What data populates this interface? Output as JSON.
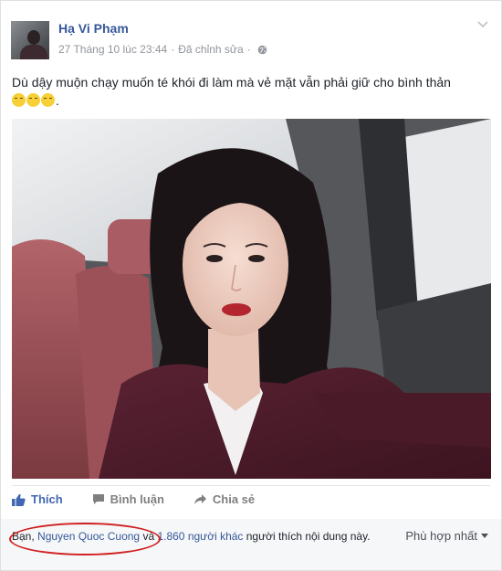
{
  "post": {
    "author": "Hạ Vi Phạm",
    "timestamp": "27 Tháng 10 lúc 23:44",
    "separator": " · ",
    "edited": "Đã chỉnh sửa",
    "privacy_icon": "globe-icon",
    "text_line1": "Dù dậy muộn chạy muốn té khói đi làm mà vẻ mặt vẫn phải giữ cho bình thản",
    "text_trailer": ".",
    "emoji_count": 3
  },
  "actions": {
    "like": "Thích",
    "comment": "Bình luận",
    "share": "Chia sẻ"
  },
  "likes": {
    "you": "Bạn",
    "comma": ", ",
    "friend": "Nguyen Quoc Cuong",
    "and": " và ",
    "others": "1.860 người khác",
    "suffix": " người thích nội dung này."
  },
  "sort": {
    "label": "Phù hợp nhất"
  },
  "colors": {
    "link": "#365899",
    "like_active": "#4267b2",
    "muted": "#90949c",
    "annotation": "#d02020"
  }
}
